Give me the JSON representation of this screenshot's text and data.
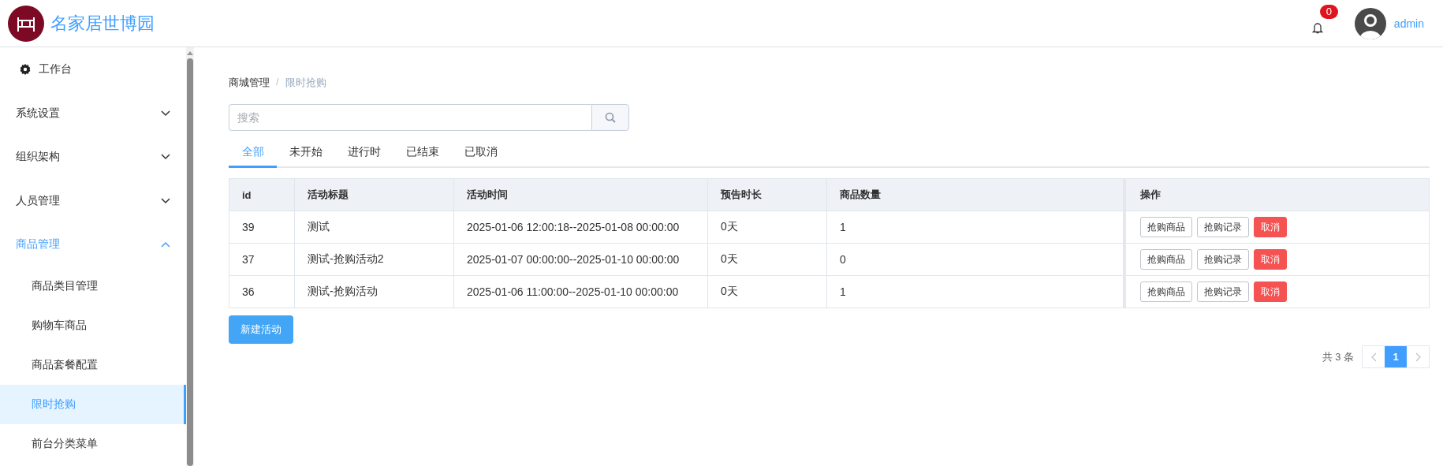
{
  "header": {
    "logo_text": "名家居世博园",
    "notification_count": "0",
    "user_name": "admin"
  },
  "sidebar": {
    "items": [
      {
        "label": "工作台",
        "kind": "link",
        "selected": false
      },
      {
        "label": "系统设置",
        "kind": "submenu",
        "expanded": false,
        "selected": false
      },
      {
        "label": "组织架构",
        "kind": "submenu",
        "expanded": false,
        "selected": false
      },
      {
        "label": "人员管理",
        "kind": "submenu",
        "expanded": false,
        "selected": false
      },
      {
        "label": "商品管理",
        "kind": "submenu",
        "expanded": true,
        "selected": false,
        "children": [
          {
            "label": "商品类目管理",
            "selected": false
          },
          {
            "label": "购物车商品",
            "selected": false
          },
          {
            "label": "商品套餐配置",
            "selected": false
          },
          {
            "label": "限时抢购",
            "selected": true
          },
          {
            "label": "前台分类菜单",
            "selected": false
          }
        ]
      }
    ]
  },
  "breadcrumb": {
    "separator": "/",
    "items": [
      "商城管理",
      "限时抢购"
    ]
  },
  "search": {
    "placeholder": "搜索"
  },
  "tabs": [
    {
      "label": "全部",
      "selected": true
    },
    {
      "label": "未开始",
      "selected": false
    },
    {
      "label": "进行时",
      "selected": false
    },
    {
      "label": "已结束",
      "selected": false
    },
    {
      "label": "已取消",
      "selected": false
    }
  ],
  "table": {
    "columns": [
      "id",
      "活动标题",
      "活动时间",
      "预告时长",
      "商品数量",
      "操作"
    ],
    "rows": [
      {
        "cells": [
          "39",
          "测试",
          "2025-01-06 12:00:18--2025-01-08 00:00:00",
          "0天",
          "1"
        ],
        "actions": [
          {
            "label": "抢购商品",
            "kind": "default"
          },
          {
            "label": "抢购记录",
            "kind": "default"
          },
          {
            "label": "取消",
            "kind": "danger"
          }
        ]
      },
      {
        "cells": [
          "37",
          "测试-抢购活动2",
          "2025-01-07 00:00:00--2025-01-10 00:00:00",
          "0天",
          "0"
        ],
        "actions": [
          {
            "label": "抢购商品",
            "kind": "default"
          },
          {
            "label": "抢购记录",
            "kind": "default"
          },
          {
            "label": "取消",
            "kind": "danger"
          }
        ]
      },
      {
        "cells": [
          "36",
          "测试-抢购活动",
          "2025-01-06 11:00:00--2025-01-10 00:00:00",
          "0天",
          "1"
        ],
        "actions": [
          {
            "label": "抢购商品",
            "kind": "default"
          },
          {
            "label": "抢购记录",
            "kind": "default"
          },
          {
            "label": "取消",
            "kind": "danger"
          }
        ]
      }
    ]
  },
  "new_button": "新建活动",
  "pagination": {
    "total": "共 3 条",
    "pages": [
      {
        "label": "1",
        "selected": true
      }
    ]
  }
}
